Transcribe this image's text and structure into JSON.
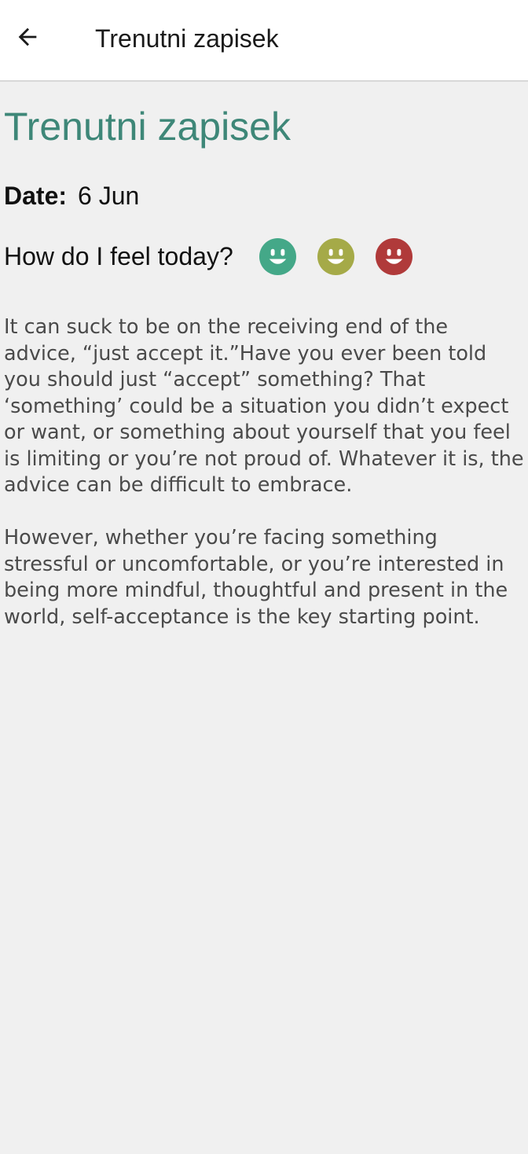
{
  "header": {
    "title": "Trenutni zapisek",
    "back_icon": "arrow-left-icon"
  },
  "entry": {
    "title": "Trenutni zapisek",
    "date_label": "Date:",
    "date_value": "6 Jun",
    "mood_question": "How do I feel today?",
    "moods": [
      {
        "name": "happy-green",
        "icon": "smiley-face-icon",
        "color": "#44a888"
      },
      {
        "name": "happy-olive",
        "icon": "smiley-face-icon",
        "color": "#a5aa48"
      },
      {
        "name": "happy-red",
        "icon": "smiley-face-icon",
        "color": "#b03a3a"
      }
    ],
    "paragraphs": [
      "It can suck to be on the receiving end of the advice, “just accept it.”Have you ever been told you should just “accept” something? That ‘something’ could be a situation you didn’t expect or want, or something about yourself that you feel is limiting or you’re not proud of. Whatever it is, the advice can be difficult to embrace.",
      "However, whether you’re facing something stressful or uncomfortable, or you’re interested in being more mindful, thoughtful and present in the world, self-acceptance is the key starting point."
    ]
  },
  "colors": {
    "accent": "#3e8778",
    "background": "#f0f0f0",
    "app_bar": "#ffffff"
  }
}
